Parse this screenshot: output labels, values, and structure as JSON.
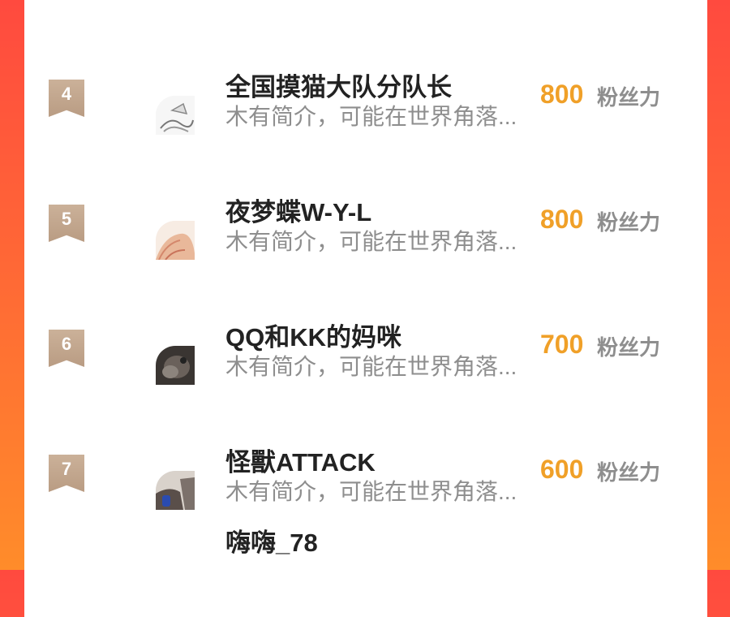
{
  "list": {
    "items": [
      {
        "rank": "4",
        "name": "全国摸猫大队分队长",
        "bio": "木有简介，可能在世界角落...",
        "score": "800",
        "unit": "粉丝力",
        "avatar": "sketch-avatar"
      },
      {
        "rank": "5",
        "name": "夜梦蝶W-Y-L",
        "bio": "木有简介，可能在世界角落...",
        "score": "800",
        "unit": "粉丝力",
        "avatar": "anime-avatar"
      },
      {
        "rank": "6",
        "name": "QQ和KK的妈咪",
        "bio": "木有简介，可能在世界角落...",
        "score": "700",
        "unit": "粉丝力",
        "avatar": "dark-photo-avatar"
      },
      {
        "rank": "7",
        "name": "怪獸ATTACK",
        "bio": "木有简介，可能在世界角落...",
        "score": "600",
        "unit": "粉丝力",
        "avatar": "hand-photo-avatar"
      }
    ],
    "next_partial_name": "嗨嗨_78"
  },
  "colors": {
    "background_top": "#ff4a3f",
    "background_bottom": "#ff8c2a",
    "score": "#f0a028",
    "rank_ribbon": "#c4a68c"
  }
}
